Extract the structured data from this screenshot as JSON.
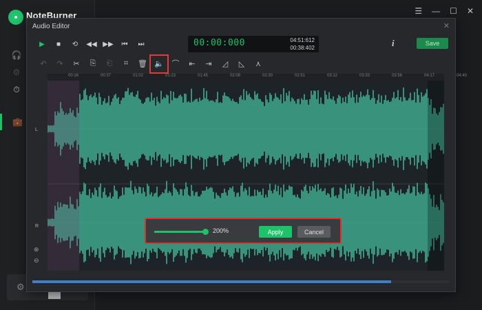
{
  "app": {
    "name": "NoteBurner",
    "nav": [
      {
        "icon": "headphones-icon",
        "glyph": "🎧"
      },
      {
        "icon": "settings-icon",
        "glyph": "⚙"
      },
      {
        "icon": "clock-icon",
        "glyph": "⏱"
      },
      {
        "icon": "toolbox-icon",
        "glyph": "💼",
        "active": true
      }
    ],
    "window_controls": [
      "☰",
      "—",
      "☐",
      "✕"
    ]
  },
  "editor": {
    "title": "Audio Editor",
    "close_glyph": "✕",
    "transport": {
      "play": "▶",
      "stop": "■",
      "loop": "⟲",
      "rewind": "◀◀",
      "forward": "▶▶",
      "prev": "⏮",
      "next": "⏭"
    },
    "time": {
      "current": "00:00:000",
      "total": "04:51:612",
      "selection": "00:38:402"
    },
    "info_glyph": "i",
    "save_label": "Save",
    "tools": [
      {
        "name": "undo-icon",
        "glyph": "↶",
        "dim": true
      },
      {
        "name": "redo-icon",
        "glyph": "↷",
        "dim": true
      },
      {
        "name": "cut-icon",
        "glyph": "✂"
      },
      {
        "name": "copy-icon",
        "glyph": "⎘"
      },
      {
        "name": "paste-icon",
        "glyph": "⎗",
        "dim": true
      },
      {
        "name": "crop-icon",
        "glyph": "⌗"
      },
      {
        "name": "delete-icon",
        "glyph": "🗑"
      },
      {
        "name": "volume-icon",
        "glyph": "🔈"
      },
      {
        "name": "amplify-icon",
        "glyph": "⌒"
      },
      {
        "name": "trim-left-icon",
        "glyph": "⇤"
      },
      {
        "name": "trim-right-icon",
        "glyph": "⇥"
      },
      {
        "name": "fade-in-icon",
        "glyph": "◿"
      },
      {
        "name": "fade-out-icon",
        "glyph": "◺"
      },
      {
        "name": "split-icon",
        "glyph": "⋏"
      }
    ],
    "ruler_labels": [
      "00:16",
      "00:37",
      "01:02",
      "01:23",
      "01:45",
      "02:08",
      "02:30",
      "02:51",
      "03:12",
      "03:33",
      "03:56",
      "04:17",
      "04:40"
    ],
    "channels": {
      "left": "L",
      "right": "R"
    },
    "zoom": {
      "in": "⊕",
      "out": "⊖"
    }
  },
  "volume_popup": {
    "level_percent": 200,
    "level_fraction": 0.97,
    "value_label": "200%",
    "apply_label": "Apply",
    "cancel_label": "Cancel"
  },
  "colors": {
    "accent": "#1fc26b",
    "highlight": "#e53935",
    "wave": "#3d9e86"
  }
}
